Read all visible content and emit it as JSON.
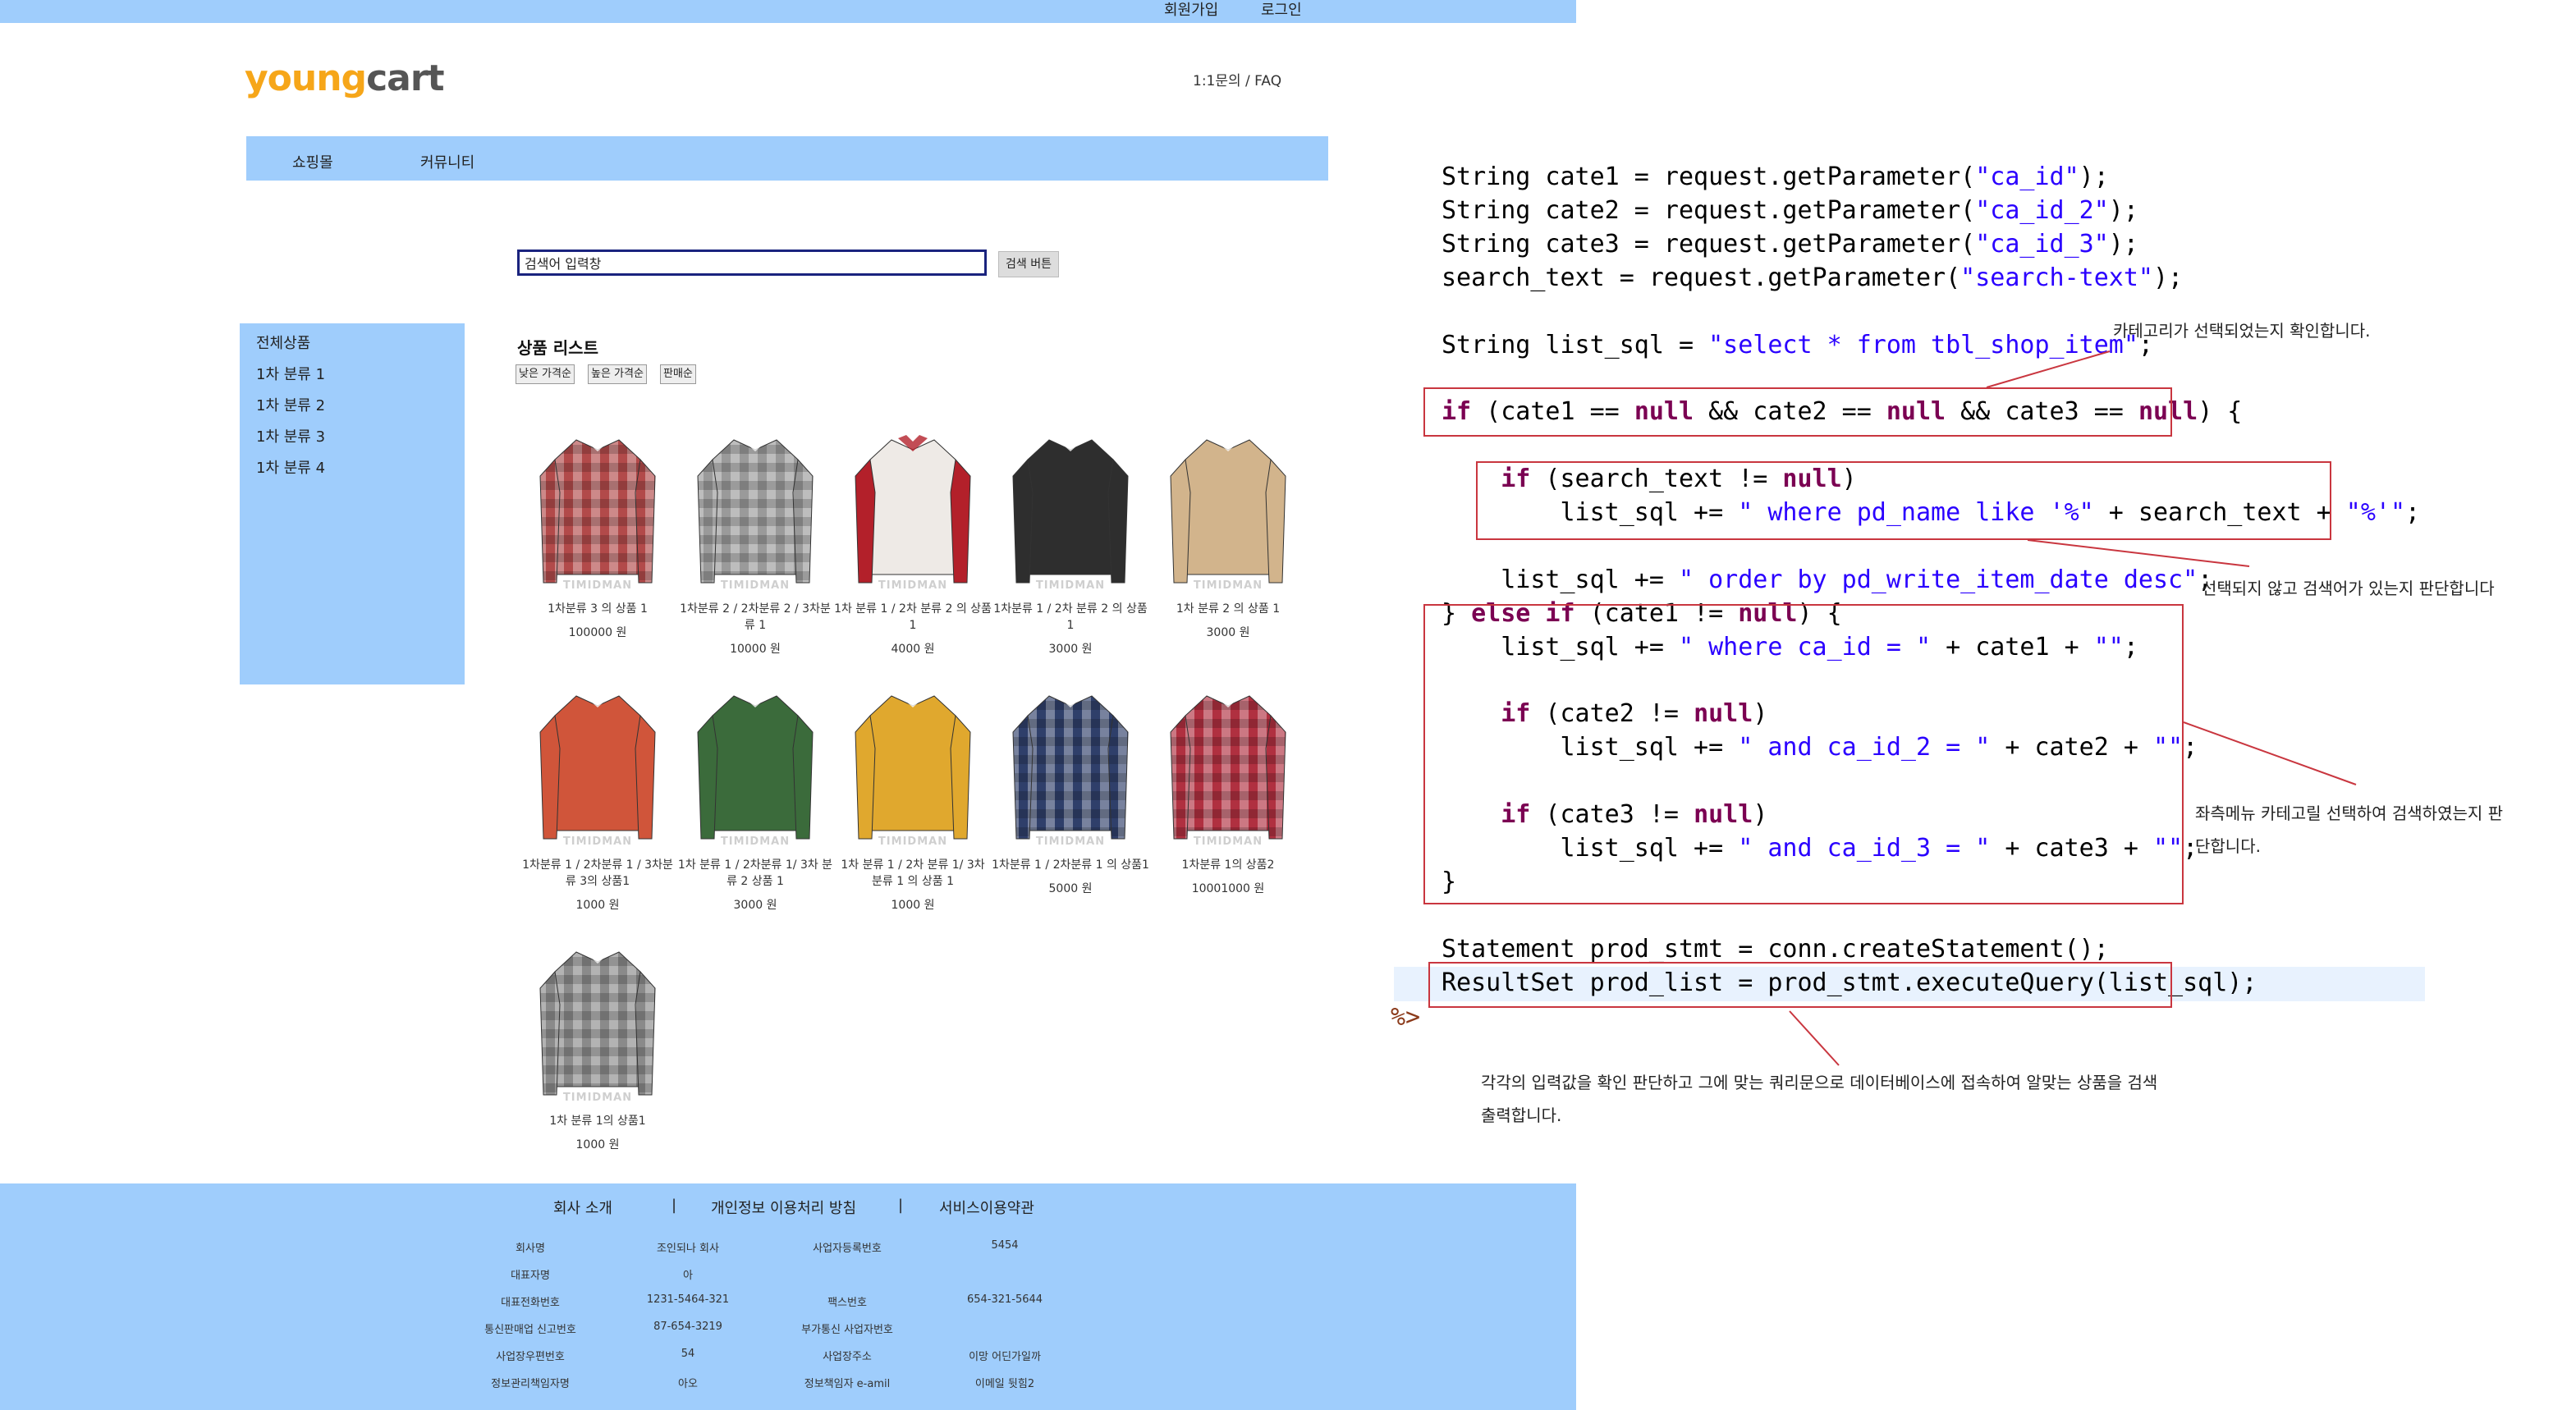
{
  "shop": {
    "top_links": [
      "회원가입",
      "로그인"
    ],
    "logo": {
      "part1": "young",
      "part2": "cart"
    },
    "faq": "1:1문의 / FAQ",
    "nav": [
      "쇼핑몰",
      "커뮤니티"
    ],
    "search": {
      "value": "검색어 입력창",
      "button": "검색 버튼"
    },
    "sidebar": [
      "전체상품",
      "1차 분류 1",
      "1차 분류 2",
      "1차 분류 3",
      "1차 분류 4"
    ],
    "list_title": "상품 리스트",
    "sort_buttons": [
      "낮은 가격순",
      "높은 가격순",
      "판매순"
    ],
    "watermark": "TIMIDMAN",
    "products": [
      {
        "name": "1차분류 3 의 상품 1",
        "price": "100000 원",
        "color": "#b24a4a",
        "pattern": "check"
      },
      {
        "name": "1차분류 2 / 2차분류 2 / 3차분류 1",
        "price": "10000 원",
        "color": "#9a9a9a",
        "pattern": "check"
      },
      {
        "name": "1차 분류 1 / 2차 분류 2 의 상품 1",
        "price": "4000 원",
        "color": "#b3202a",
        "pattern": "raglan"
      },
      {
        "name": "1차분류 1 / 2차 분류 2 의 상품 1",
        "price": "3000 원",
        "color": "#2e2e2e",
        "pattern": "solid"
      },
      {
        "name": "1차 분류 2 의 상품 1",
        "price": "3000 원",
        "color": "#d2b48c",
        "pattern": "solid"
      },
      {
        "name": "1차분류 1 / 2차분류 1 / 3차분류 3의 상품1",
        "price": "1000 원",
        "color": "#d0553a",
        "pattern": "solid"
      },
      {
        "name": "1차 분류 1 / 2차분류 1/ 3차 분류 2 상품 1",
        "price": "3000 원",
        "color": "#3b6b3b",
        "pattern": "solid"
      },
      {
        "name": "1차 분류 1 / 2차 분류 1/ 3차 분류 1 의 상품 1",
        "price": "1000 원",
        "color": "#e0a82e",
        "pattern": "solid"
      },
      {
        "name": "1차분류 1 / 2차분류 1 의 상품1",
        "price": "5000 원",
        "color": "#2f3f6a",
        "pattern": "check"
      },
      {
        "name": "1차분류 1의 상품2",
        "price": "10001000 원",
        "color": "#b03040",
        "pattern": "check"
      },
      {
        "name": "1차 분류 1의 상품1",
        "price": "1000 원",
        "color": "#8a8a8a",
        "pattern": "check"
      }
    ],
    "footer": {
      "links": [
        "회사 소개",
        "개인정보 이용처리 방침",
        "서비스이용약관"
      ],
      "separator": "|",
      "rows": [
        [
          "회사명",
          "조인되나 회사",
          "사업자등록번호",
          "5454"
        ],
        [
          "대표자명",
          "아",
          "",
          ""
        ],
        [
          "대표전화번호",
          "1231-5464-321",
          "팩스번호",
          "654-321-5644"
        ],
        [
          "통신판매업 신고번호",
          "87-654-3219",
          "부가통신 사업자번호",
          ""
        ],
        [
          "사업장우편번호",
          "54",
          "사업장주소",
          "이망 어딘가일까"
        ],
        [
          "정보관리책임자명",
          "아오",
          "정보책임자 e-amil",
          "이메일 뒷힘2"
        ]
      ]
    }
  },
  "code": {
    "lines": [
      [
        {
          "t": "String cate1 = request.getParameter("
        },
        {
          "s": "\"ca_id\""
        },
        {
          "t": ");"
        }
      ],
      [
        {
          "t": "String cate2 = request.getParameter("
        },
        {
          "s": "\"ca_id_2\""
        },
        {
          "t": ");"
        }
      ],
      [
        {
          "t": "String cate3 = request.getParameter("
        },
        {
          "s": "\"ca_id_3\""
        },
        {
          "t": ");"
        }
      ],
      [
        {
          "t": "search_text = request.getParameter("
        },
        {
          "s": "\"search-text\""
        },
        {
          "t": ");"
        }
      ],
      [],
      [
        {
          "t": "String list_sql = "
        },
        {
          "s": "\"select * from tbl_shop_item\""
        },
        {
          "t": ";"
        }
      ],
      [],
      [
        {
          "k": "if"
        },
        {
          "t": " (cate1 == "
        },
        {
          "k": "null"
        },
        {
          "t": " && cate2 == "
        },
        {
          "k": "null"
        },
        {
          "t": " && cate3 == "
        },
        {
          "k": "null"
        },
        {
          "t": ") {"
        }
      ],
      [],
      [
        {
          "t": "    "
        },
        {
          "k": "if"
        },
        {
          "t": " (search_text != "
        },
        {
          "k": "null"
        },
        {
          "t": ")"
        }
      ],
      [
        {
          "t": "        list_sql += "
        },
        {
          "s": "\" where pd_name like '%\""
        },
        {
          "t": " + search_text + "
        },
        {
          "s": "\"%'\""
        },
        {
          "t": ";"
        }
      ],
      [],
      [
        {
          "t": "    list_sql += "
        },
        {
          "s": "\" order by pd_write_item_date desc\""
        },
        {
          "t": ";"
        }
      ],
      [
        {
          "t": "} "
        },
        {
          "k": "else if"
        },
        {
          "t": " (cate1 != "
        },
        {
          "k": "null"
        },
        {
          "t": ") {"
        }
      ],
      [
        {
          "t": "    list_sql += "
        },
        {
          "s": "\" where ca_id = \""
        },
        {
          "t": " + cate1 + "
        },
        {
          "s": "\"\""
        },
        {
          "t": ";"
        }
      ],
      [],
      [
        {
          "t": "    "
        },
        {
          "k": "if"
        },
        {
          "t": " (cate2 != "
        },
        {
          "k": "null"
        },
        {
          "t": ")"
        }
      ],
      [
        {
          "t": "        list_sql += "
        },
        {
          "s": "\" and ca_id_2 = \""
        },
        {
          "t": " + cate2 + "
        },
        {
          "s": "\"\""
        },
        {
          "t": ";"
        }
      ],
      [],
      [
        {
          "t": "    "
        },
        {
          "k": "if"
        },
        {
          "t": " (cate3 != "
        },
        {
          "k": "null"
        },
        {
          "t": ")"
        }
      ],
      [
        {
          "t": "        list_sql += "
        },
        {
          "s": "\" and ca_id_3 = \""
        },
        {
          "t": " + cate3 + "
        },
        {
          "s": "\"\""
        },
        {
          "t": ";"
        }
      ],
      [
        {
          "t": "}"
        }
      ],
      [],
      [
        {
          "t": "Statement prod_stmt = conn.createStatement();"
        }
      ],
      [
        {
          "t": "ResultSet prod_list = prod_stmt.executeQuery(list_sql);"
        }
      ]
    ],
    "end_tag": "%>"
  },
  "notes": {
    "n1": "카테고리가 선택되었는지 확인합니다.",
    "n2": "선택되지 않고 검색어가 있는지 판단합니다",
    "n3a": "좌측메뉴 카테고릴 선택하여 검색하였는지 판",
    "n3b": "단합니다.",
    "n4a": "각각의 입력값을 확인 판단하고 그에 맞는 쿼리문으로 데이터베이스에 접속하여 알맞는 상품을 검색",
    "n4b": "출력합니다."
  },
  "colors": {
    "accent": "#9fcdfc",
    "annotation": "#c9363f",
    "keyword": "#7b0052",
    "string": "#2a00ff"
  }
}
